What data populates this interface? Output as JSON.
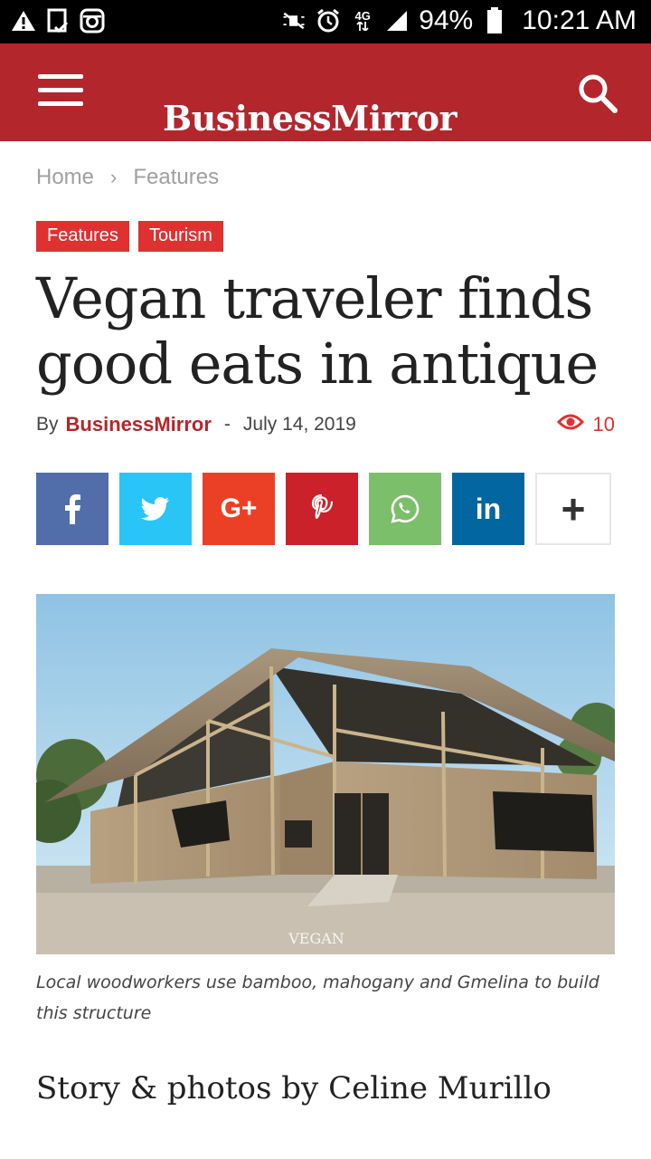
{
  "status_bar": {
    "battery": "94%",
    "time": "10:21 AM",
    "network": "4G",
    "left_icons": [
      "warning-icon",
      "clipboard-check-icon",
      "instagram-icon"
    ],
    "right_icons": [
      "mute-icon",
      "alarm-icon",
      "network-icon",
      "signal-icon",
      "battery-icon"
    ]
  },
  "header": {
    "logo": "BusinessMirror",
    "menu_icon": "hamburger-menu-icon",
    "search_icon": "search-icon",
    "color": "#b3262b"
  },
  "breadcrumb": {
    "home": "Home",
    "separator": "›",
    "current": "Features"
  },
  "tags": [
    "Features",
    "Tourism"
  ],
  "article": {
    "title": "Vegan traveler finds good eats in antique",
    "by": "By",
    "author": "BusinessMirror",
    "dash": "-",
    "date": "July 14, 2019",
    "views": "10",
    "image_watermark": "VEGAN",
    "caption": "Local woodworkers use bamboo, mahogany and Gmelina to build this structure",
    "byline": "Story & photos by Celine Murillo"
  },
  "share_buttons": [
    {
      "name": "facebook",
      "label": "f",
      "color": "#516eab"
    },
    {
      "name": "twitter",
      "label": "",
      "color": "#29c5f6"
    },
    {
      "name": "google-plus",
      "label": "G+",
      "color": "#eb4026"
    },
    {
      "name": "pinterest",
      "label": "",
      "color": "#ca212a"
    },
    {
      "name": "whatsapp",
      "label": "",
      "color": "#7bbf6a"
    },
    {
      "name": "linkedin",
      "label": "in",
      "color": "#0266a0"
    },
    {
      "name": "more",
      "label": "+",
      "color": "#ffffff"
    }
  ],
  "colors": {
    "tag": "#e03131",
    "accent": "#b3262b"
  }
}
